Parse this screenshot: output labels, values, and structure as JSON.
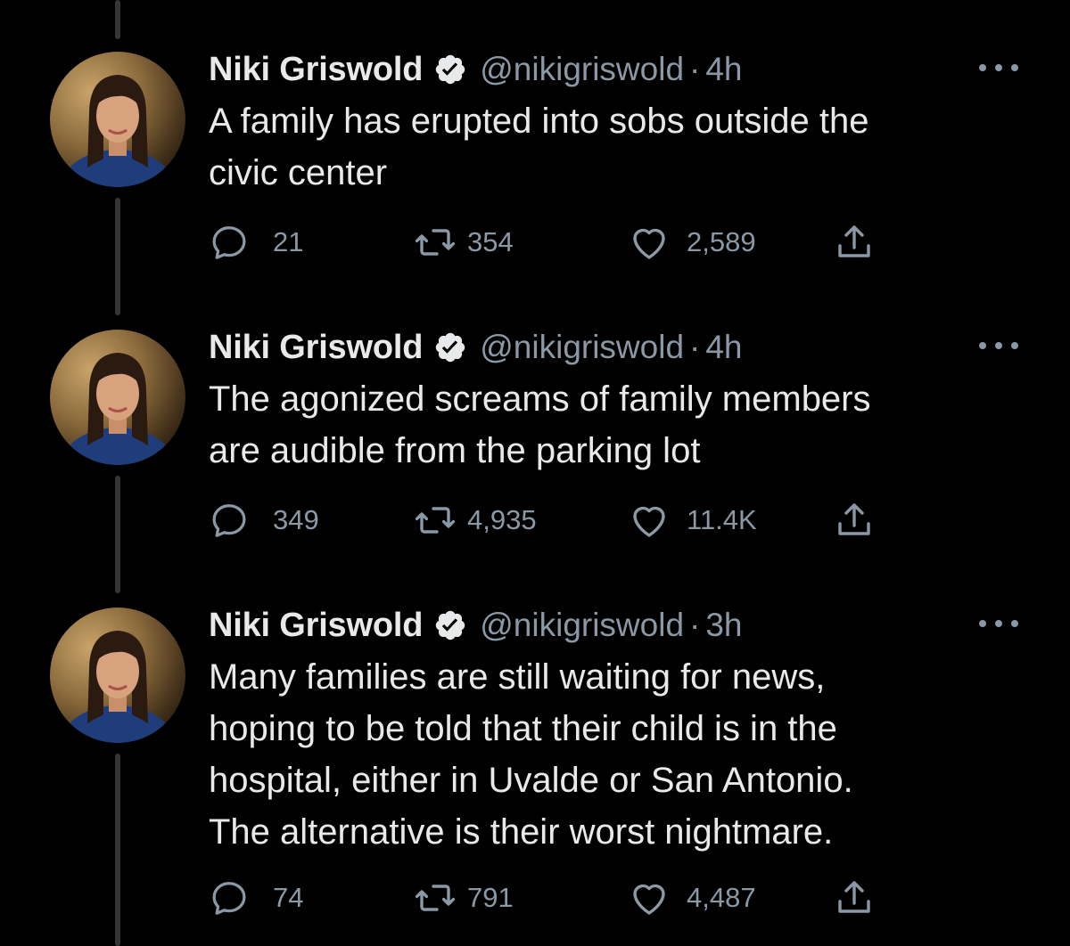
{
  "thread": [
    {
      "name": "Niki Griswold",
      "handle": "@nikigriswold",
      "separator": "·",
      "time": "4h",
      "text": "A family has erupted into sobs outside the\ncivic center",
      "replies": "21",
      "retweets": "354",
      "likes": "2,589"
    },
    {
      "name": "Niki Griswold",
      "handle": "@nikigriswold",
      "separator": "·",
      "time": "4h",
      "text": "The agonized screams of family members\nare audible from the parking lot",
      "replies": "349",
      "retweets": "4,935",
      "likes": "11.4K"
    },
    {
      "name": "Niki Griswold",
      "handle": "@nikigriswold",
      "separator": "·",
      "time": "3h",
      "text": "Many families are still waiting for news,\nhoping to be told that their child is in the\nhospital, either in Uvalde or San Antonio.\nThe alternative is their worst nightmare.",
      "replies": "74",
      "retweets": "791",
      "likes": "4,487"
    }
  ],
  "icons": {
    "verified": "verified-badge-icon",
    "more": "more-horizontal-icon",
    "reply": "reply-icon",
    "retweet": "retweet-icon",
    "like": "heart-icon",
    "share": "share-icon"
  },
  "colors": {
    "background": "#000000",
    "text": "#e7e9ea",
    "secondary": "#8b98a5",
    "thread_line": "#333639"
  }
}
